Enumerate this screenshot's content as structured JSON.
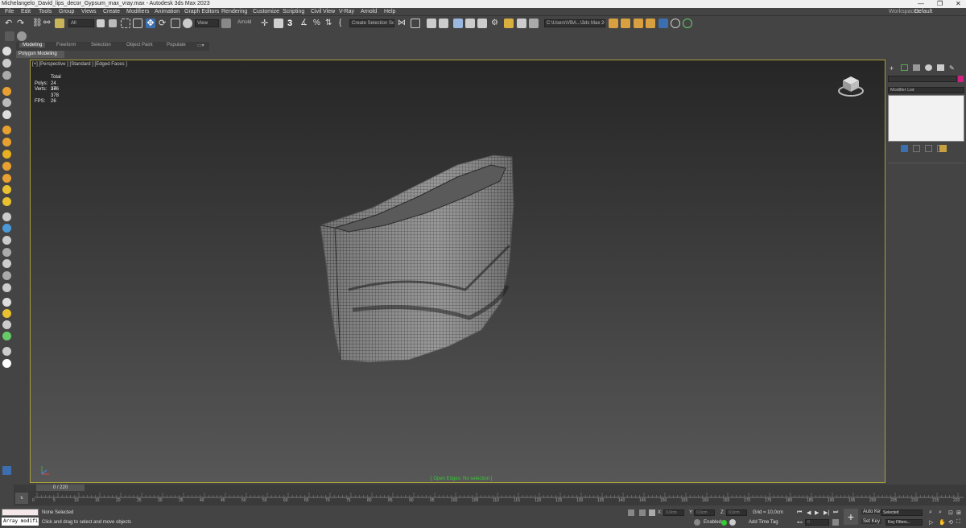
{
  "window": {
    "title": "Michelangelo_David_lips_decor_Gypsum_max_vray.max - Autodesk 3ds Max 2023",
    "min": "—",
    "max": "❐",
    "close": "✕"
  },
  "menu": [
    "File",
    "Edit",
    "Tools",
    "Group",
    "Views",
    "Create",
    "Modifiers",
    "Animation",
    "Graph Editors",
    "Rendering",
    "Customize",
    "Scripting",
    "Civil View",
    "V-Ray",
    "Arnold",
    "Help"
  ],
  "workspaces": {
    "label": "Workspaces:",
    "value": "Default"
  },
  "toolbar": {
    "filter": "All",
    "ref_coord": "View",
    "arnold": "Arnold",
    "selection_set": "Create Selection Se",
    "project_path": "C:\\Users\\VBA...\\3ds Max 2023"
  },
  "ribbon": {
    "tabs": [
      "Modeling",
      "Freeform",
      "Selection",
      "Object Paint",
      "Populate"
    ],
    "panel": "Polygon Modeling"
  },
  "viewport": {
    "label": "[+] [Perspective ] [Standard ] [Edged Faces ]",
    "stats": {
      "total": "Total",
      "polys_label": "Polys:",
      "polys": "24 376",
      "verts_label": "Verts:",
      "verts": "24 378",
      "fps_label": "FPS:",
      "fps": "26"
    },
    "status": "[ Open Edges: No selection ]"
  },
  "right_panel": {
    "modifier_list": "Modifier List"
  },
  "timeline": {
    "frame": "0 / 220",
    "ticks": [
      "0",
      "5",
      "10",
      "15",
      "20",
      "25",
      "30",
      "35",
      "40",
      "45",
      "50",
      "55",
      "60",
      "65",
      "70",
      "75",
      "80",
      "85",
      "90",
      "95",
      "100",
      "105",
      "110",
      "115",
      "120",
      "125",
      "130",
      "135",
      "140",
      "145",
      "150",
      "155",
      "160",
      "165",
      "170",
      "175",
      "180",
      "185",
      "190",
      "195",
      "200",
      "205",
      "210",
      "215",
      "220"
    ]
  },
  "status_bar": {
    "maxscript": "Array modifi",
    "selection": "None Selected",
    "hint": "Click and drag to select and move objects",
    "x_label": "X:",
    "x_value": "0,0cm",
    "y_label": "Y:",
    "y_value": "0,0cm",
    "z_label": "Z:",
    "z_value": "0,0cm",
    "grid": "Grid = 10,0cm",
    "enabled": "Enabled:",
    "add_time_tag": "Add Time Tag",
    "auto_key": "Auto Key",
    "set_key": "Set Key",
    "selected": "Selected",
    "key_filters": "Key Filters...",
    "frame_field": "0"
  }
}
